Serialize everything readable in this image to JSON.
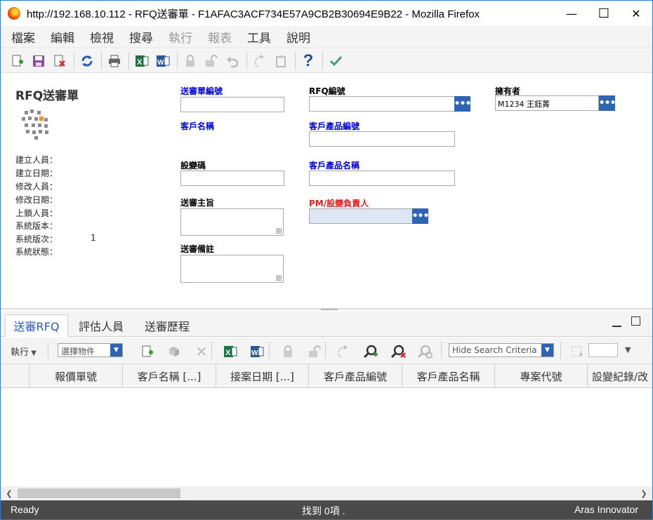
{
  "window": {
    "title": "http://192.168.10.112 - RFQ送審單 - F1AFAC3ACF734E57A9CB2B30694E9B22 - Mozilla Firefox",
    "minimize": "—",
    "maximize": "☐",
    "close": "✕"
  },
  "menu": [
    "檔案",
    "編輯",
    "檢視",
    "搜尋",
    "執行",
    "報表",
    "工具",
    "說明"
  ],
  "form": {
    "title": "RFQ送審單",
    "meta_labels": [
      "建立人員：",
      "建立日期：",
      "修改人員：",
      "修改日期：",
      "上鎖人員：",
      "系統版本：",
      "系統版次：",
      "系統狀態："
    ],
    "generation_value": "1",
    "fields": {
      "rfq_no_label": "送審單編號",
      "customer_name_label": "客戶名稱",
      "design_code_label": "設變碼",
      "subject_label": "送審主旨",
      "remark_label": "送審備註",
      "rfq_id_label": "RFQ編號",
      "cust_part_no_label": "客戶產品編號",
      "cust_part_name_label": "客戶產品名稱",
      "pm_label": "PM/設變負責人",
      "owner_label": "擁有者",
      "owner_value": "M1234 王鈺菁",
      "ellipsis": "•••"
    }
  },
  "tabs": [
    "送審RFQ",
    "評估人員",
    "送審歷程"
  ],
  "relgrid": {
    "actions_label": "執行",
    "pick_item_placeholder": "選擇物件",
    "search_mode": "Hide Search Criteria",
    "columns": [
      "報價單號",
      "客戶名稱 [...]",
      "接案日期 [...]",
      "客戶產品編號",
      "客戶產品名稱",
      "專案代號",
      "設變紀錄/改"
    ]
  },
  "status": {
    "left": "Ready",
    "center": "找到 0項 .",
    "right": "Aras Innovator"
  }
}
